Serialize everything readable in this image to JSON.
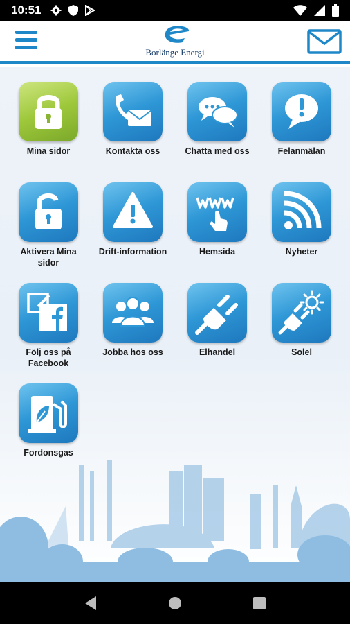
{
  "status_bar": {
    "time": "10:51",
    "left_icons": [
      "gear-icon",
      "shield-icon",
      "play-store-icon"
    ],
    "right_icons": [
      "wifi-icon",
      "signal-icon",
      "battery-icon"
    ]
  },
  "header": {
    "brand_name": "Borlänge Energi",
    "menu_icon": "hamburger-icon",
    "mail_icon": "mail-icon",
    "accent_color": "#1e87c8"
  },
  "tiles": [
    {
      "label": "Mina sidor",
      "icon": "lock-icon",
      "color": "#9ec83b"
    },
    {
      "label": "Kontakta oss",
      "icon": "phone-mail-icon",
      "color": "#2e97d6"
    },
    {
      "label": "Chatta med oss",
      "icon": "chat-icon",
      "color": "#2e97d6"
    },
    {
      "label": "Felanmälan",
      "icon": "exclamation-bubble-icon",
      "color": "#2e97d6"
    },
    {
      "label": "Aktivera Mina sidor",
      "icon": "unlock-icon",
      "color": "#2e97d6"
    },
    {
      "label": "Drift-information",
      "icon": "warning-icon",
      "color": "#2e97d6"
    },
    {
      "label": "Hemsida",
      "icon": "www-icon",
      "color": "#2e97d6"
    },
    {
      "label": "Nyheter",
      "icon": "rss-icon",
      "color": "#2e97d6"
    },
    {
      "label": "Följ oss på Facebook",
      "icon": "facebook-icon",
      "color": "#2e97d6"
    },
    {
      "label": "Jobba hos oss",
      "icon": "people-icon",
      "color": "#2e97d6"
    },
    {
      "label": "Elhandel",
      "icon": "plug-icon",
      "color": "#2e97d6"
    },
    {
      "label": "Solel",
      "icon": "sun-plug-icon",
      "color": "#2e97d6"
    },
    {
      "label": "Fordonsgas",
      "icon": "gas-pump-icon",
      "color": "#2e97d6"
    }
  ],
  "nav_bar": {
    "back_icon": "back-icon",
    "home_icon": "home-icon",
    "recents_icon": "recents-icon"
  }
}
